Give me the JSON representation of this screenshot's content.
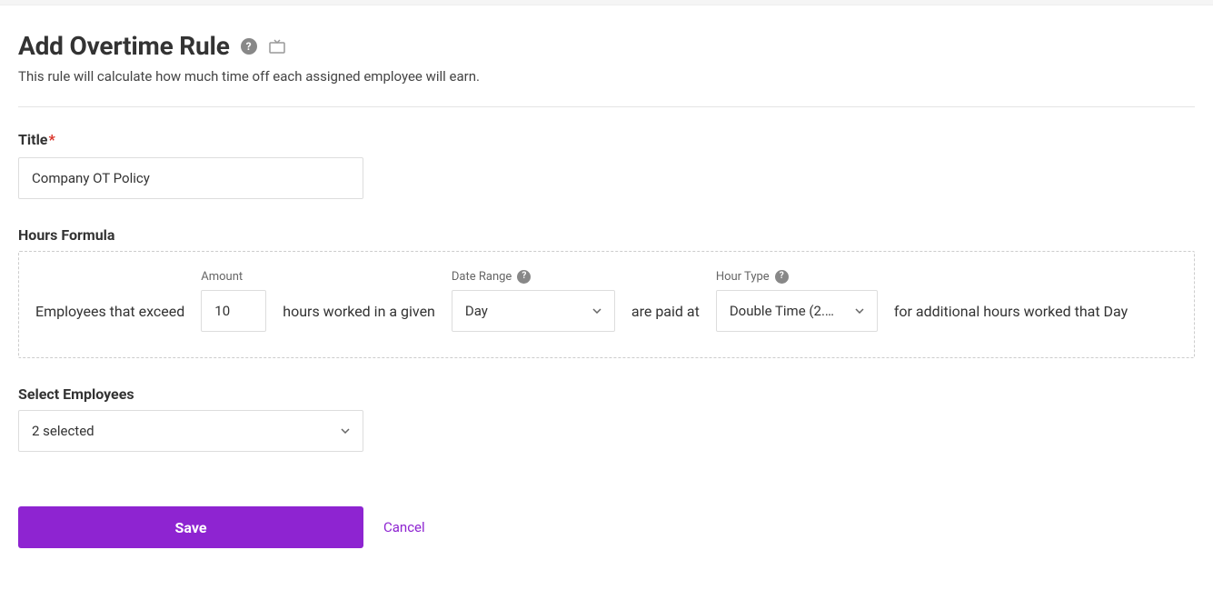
{
  "header": {
    "title": "Add Overtime Rule",
    "subtitle": "This rule will calculate how much time off each assigned employee will earn."
  },
  "fields": {
    "title": {
      "label": "Title",
      "value": "Company OT Policy"
    }
  },
  "formula": {
    "section_label": "Hours Formula",
    "text1": "Employees that exceed",
    "amount_label": "Amount",
    "amount_value": "10",
    "text2": "hours worked in a given",
    "date_range_label": "Date Range",
    "date_range_value": "Day",
    "text3": "are paid at",
    "hour_type_label": "Hour Type",
    "hour_type_value": "Double Time (2.…",
    "text4": "for additional hours worked that Day"
  },
  "employees": {
    "label": "Select Employees",
    "value": "2 selected"
  },
  "actions": {
    "save": "Save",
    "cancel": "Cancel"
  }
}
